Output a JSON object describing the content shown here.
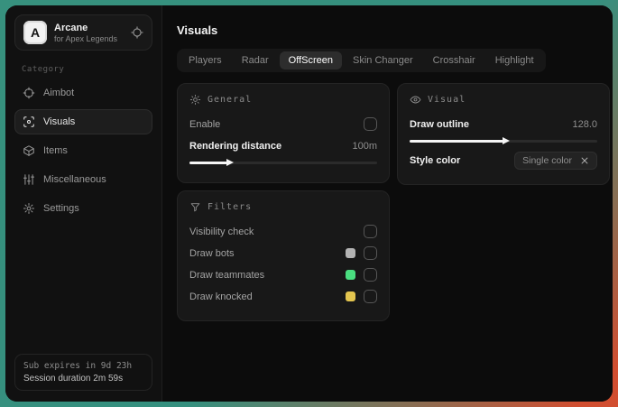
{
  "colors": {
    "frame_teal": "#35907f",
    "frame_red": "#d14e30",
    "swatch_bots": "#b3b3b3",
    "swatch_teammates": "#4ade80",
    "swatch_knocked": "#e3c54f"
  },
  "sidebar": {
    "logo_letter": "A",
    "app_name": "Arcane",
    "app_subtitle": "for Apex Legends",
    "category_label": "Category",
    "items": [
      {
        "label": "Aimbot"
      },
      {
        "label": "Visuals",
        "active": true
      },
      {
        "label": "Items"
      },
      {
        "label": "Miscellaneous"
      },
      {
        "label": "Settings"
      }
    ],
    "status": {
      "line1": "Sub expires in 9d 23h",
      "line2": "Session duration 2m 59s"
    }
  },
  "header": {
    "title": "Visuals"
  },
  "tabs": [
    {
      "label": "Players"
    },
    {
      "label": "Radar"
    },
    {
      "label": "OffScreen",
      "active": true
    },
    {
      "label": "Skin Changer"
    },
    {
      "label": "Crosshair"
    },
    {
      "label": "Highlight"
    }
  ],
  "panels": {
    "general": {
      "title": "General",
      "enable_label": "Enable",
      "rendering_label": "Rendering distance",
      "rendering_value": "100m",
      "rendering_fill": "20%"
    },
    "filters": {
      "title": "Filters",
      "rows": [
        {
          "label": "Visibility check"
        },
        {
          "label": "Draw bots",
          "swatch": "#b3b3b3"
        },
        {
          "label": "Draw teammates",
          "swatch": "#4ade80"
        },
        {
          "label": "Draw knocked",
          "swatch": "#e3c54f"
        }
      ]
    },
    "visual": {
      "title": "Visual",
      "outline_label": "Draw outline",
      "outline_value": "128.0",
      "outline_fill": "50%",
      "style_label": "Style color",
      "style_value": "Single color"
    }
  }
}
